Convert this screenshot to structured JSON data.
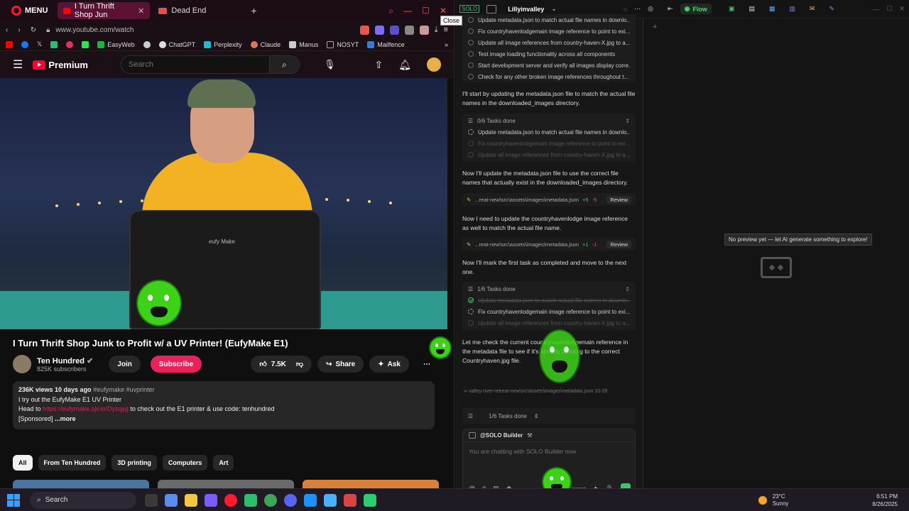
{
  "browser": {
    "menu_label": "MENU",
    "tabs": [
      {
        "label": "I Turn Thrift Shop Jun"
      },
      {
        "label": "Dead End"
      }
    ],
    "close_tooltip": "Close",
    "url": "www.youtube.com/watch",
    "bookmarks": [
      {
        "label": "EasyWeb",
        "color": "#19b34a"
      },
      {
        "label": "ChatGPT",
        "color": "#dddddd"
      },
      {
        "label": "Perplexity",
        "color": "#20b8cd"
      },
      {
        "label": "Claude",
        "color": "#d97757"
      },
      {
        "label": "Manus",
        "color": "#cccccc"
      },
      {
        "label": "NOSYT",
        "color": "#aaaaaa"
      },
      {
        "label": "Mailfence",
        "color": "#3a7bd5"
      }
    ]
  },
  "youtube": {
    "logo_text": "Premium",
    "search_placeholder": "Search",
    "video": {
      "title": "I Turn Thrift Shop Junk to Profit w/ a UV Printer! (EufyMake E1)",
      "printer_label": "eufy Make",
      "channel_name": "Ten Hundred",
      "subscribers": "825K subscribers",
      "join_label": "Join",
      "subscribe_label": "Subscribe",
      "likes": "7.5K",
      "share_label": "Share",
      "ask_label": "Ask",
      "views_date": "236K views  10 days ago",
      "hashtags": "#eufymake #uvprinter",
      "desc_line1": "I try out the EufyMake E1 UV Printer",
      "desc_line2_prefix": "Head to ",
      "desc_link": "https://eufymake.sjv.io/Dyzqyg",
      "desc_line2_suffix": " to check out the E1 printer & use code: tenhundred",
      "desc_line3": "[Sponsored]",
      "more_label": "...more"
    },
    "chips": [
      "All",
      "From Ten Hundred",
      "3D printing",
      "Computers",
      "Art"
    ]
  },
  "solo": {
    "logo": "SOLO",
    "user": "Lillyinvalley",
    "flow_label": "Flow",
    "todos_top": [
      "Update metadata.json to match actual file names in downlo...",
      "Fix countryhavenlodgemain image reference to point to exi...",
      "Update all image references from country-haven-X.jpg to a...",
      "Test image loading functionality across all components",
      "Start development server and verify all images display corre...",
      "Check for any other broken image references throughout t..."
    ],
    "msg1": "I'll start by updating the metadata.json file to match the actual file names in the downloaded_images directory.",
    "card1": {
      "header": "0/6 Tasks done",
      "items": [
        "Update metadata.json to match actual file names in downlo...",
        "Fix countryhavenlodgemain image reference to point to exi...",
        "Update all image references from country-haven-X.jpg to a..."
      ]
    },
    "msg2": "Now I'll update the metadata.json file to use the correct file names that actually exist in the downloaded_images directory.",
    "file1": {
      "path": "...reat-new\\src\\assets\\images\\metadata.json",
      "added": "+5",
      "removed": "-5",
      "review": "Review"
    },
    "msg3": "Now I need to update the countryhavenlodge image reference as well to match the actual file name.",
    "file2": {
      "path": "...reat-new\\src\\assets\\images\\metadata.json",
      "added": "+1",
      "removed": "-1",
      "review": "Review"
    },
    "msg4": "Now I'll mark the first task as completed and move to the next one.",
    "card2": {
      "header": "1/6 Tasks done",
      "items": [
        "Update metadata.json to match actual file names in downlo...",
        "Fix countryhavenlodgemain image reference to point to exi...",
        "Update all image references from country-haven-X.jpg to a..."
      ]
    },
    "msg5": "Let me check the current countryhavenlodgemain reference in the metadata file to see if it's already pointing to the correct Countryhaven.jpg file.",
    "file_ref": "valley-river-retreat-new\\src\\assets\\images\\metadata.json  10-28",
    "bottom_tasks": "1/6 Tasks done",
    "composer_title": "@SOLO Builder",
    "composer_placeholder": "You are chatting with SOLO Builder now",
    "model": "Claude-4-Sonnet",
    "preview_empty": "No preview yet — let AI generate something to explore!"
  },
  "taskbar": {
    "search_label": "Search",
    "weather_temp": "23°C",
    "weather_desc": "Sunny",
    "time": "6:51 PM",
    "date": "8/26/2025",
    "apps": [
      {
        "name": "task-view",
        "color": "#3a3a3a"
      },
      {
        "name": "copilot",
        "color": "#5b8dee"
      },
      {
        "name": "file-explorer",
        "color": "#f2c744"
      },
      {
        "name": "app-badge",
        "color": "#7a5cff"
      },
      {
        "name": "opera",
        "color": "#ff1b2d"
      },
      {
        "name": "app-green",
        "color": "#2dbd6e"
      },
      {
        "name": "chrome",
        "color": "#3aa757"
      },
      {
        "name": "discord",
        "color": "#5865f2"
      },
      {
        "name": "app-blue",
        "color": "#1e90ff"
      },
      {
        "name": "notepad",
        "color": "#4ab0ff"
      },
      {
        "name": "app-red",
        "color": "#d94444"
      },
      {
        "name": "solo",
        "color": "#2ecc71"
      }
    ]
  }
}
